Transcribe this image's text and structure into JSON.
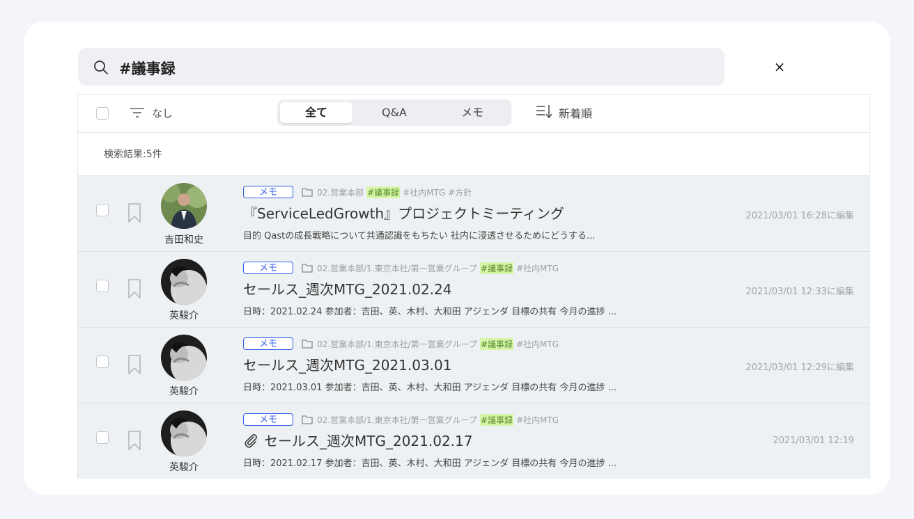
{
  "search": {
    "query": "#議事録",
    "clear_label": "×"
  },
  "toolbar": {
    "filter_label": "なし",
    "tabs": [
      {
        "label": "全て",
        "active": true
      },
      {
        "label": "Q&A",
        "active": false
      },
      {
        "label": "メモ",
        "active": false
      }
    ],
    "sort_label": "新着順"
  },
  "results": {
    "count_label": "検索結果:5件",
    "items": [
      {
        "badge": "メモ",
        "folder": "02.営業本部",
        "highlight_tag": "#議事録",
        "tags": "#社内MTG #方針",
        "title": "『ServiceLedGrowth』プロジェクトミーティング",
        "excerpt": "目的 Qastの成長戦略について共通認識をもちたい 社内に浸透させるためにどうする...",
        "author": "吉田和史",
        "date": "2021/03/01 16:28に編集",
        "has_attachment": false
      },
      {
        "badge": "メモ",
        "folder": "02.営業本部/1.東京本社/第一営業グループ",
        "highlight_tag": "#議事録",
        "tags": "#社内MTG",
        "title": "セールス_週次MTG_2021.02.24",
        "excerpt": "日時：2021.02.24 参加者：吉田、英、木村、大和田 アジェンダ 目標の共有 今月の進捗 ...",
        "author": "英駿介",
        "date": "2021/03/01 12:33に編集",
        "has_attachment": false
      },
      {
        "badge": "メモ",
        "folder": "02.営業本部/1.東京本社/第一営業グループ",
        "highlight_tag": "#議事録",
        "tags": "#社内MTG",
        "title": "セールス_週次MTG_2021.03.01",
        "excerpt": "日時：2021.03.01 参加者：吉田、英、木村、大和田 アジェンダ 目標の共有 今月の進捗 ...",
        "author": "英駿介",
        "date": "2021/03/01 12:29に編集",
        "has_attachment": false
      },
      {
        "badge": "メモ",
        "folder": "02.営業本部/1.東京本社/第一営業グループ",
        "highlight_tag": "#議事録",
        "tags": "#社内MTG",
        "title": "セールス_週次MTG_2021.02.17",
        "excerpt": "日時：2021.02.17 参加者：吉田、英、木村、大和田 アジェンダ 目標の共有 今月の進捗 ...",
        "author": "英駿介",
        "date": "2021/03/01 12:19",
        "has_attachment": true
      }
    ]
  },
  "colors": {
    "accent": "#2f5bea",
    "highlight_bg": "#d6f5a8",
    "row_bg": "#eef1f3"
  }
}
